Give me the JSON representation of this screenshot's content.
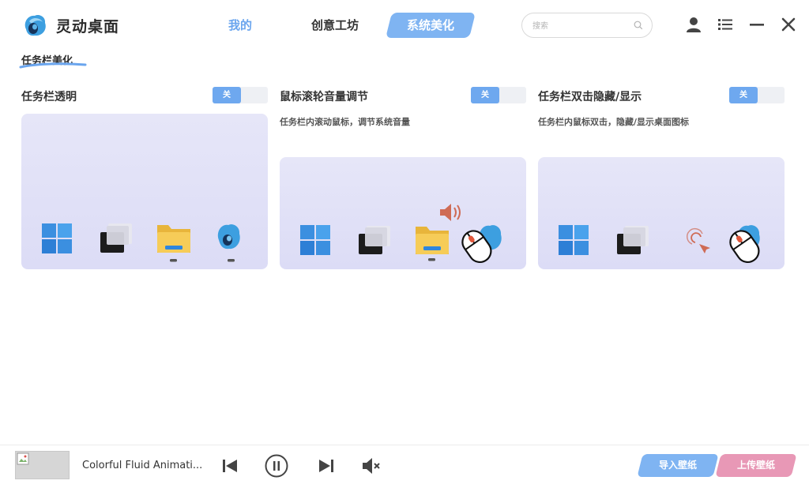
{
  "app": {
    "title": "灵动桌面"
  },
  "nav": {
    "tabs": [
      {
        "label": "我的",
        "active": false
      },
      {
        "label": "创意工坊",
        "active": false
      },
      {
        "label": "系统美化",
        "active": true
      }
    ]
  },
  "search": {
    "placeholder": "搜索",
    "value": ""
  },
  "window_controls": [
    "user-icon",
    "list-menu-icon",
    "minimize-icon",
    "close-icon"
  ],
  "section": {
    "title": "任务栏美化"
  },
  "features": [
    {
      "name": "任务栏透明",
      "description": "",
      "toggle_label": "关",
      "enabled": false
    },
    {
      "name": "鼠标滚轮音量调节",
      "description": "任务栏内滚动鼠标，调节系统音量",
      "toggle_label": "关",
      "enabled": false
    },
    {
      "name": "任务栏双击隐藏/显示",
      "description": "任务栏内鼠标双击，隐藏/显示桌面图标",
      "toggle_label": "关",
      "enabled": false
    }
  ],
  "player": {
    "track_title": "Colorful Fluid Animati...",
    "controls": [
      "previous-icon",
      "pause-icon",
      "next-icon",
      "mute-icon"
    ]
  },
  "actions": {
    "import_label": "导入壁纸",
    "upload_label": "上传壁纸"
  },
  "colors": {
    "accent_blue": "#7fb4f2",
    "active_tab_text": "#6aa5ee",
    "upload_pink": "#e898b6",
    "toggle_blue": "#6ea8ef",
    "preview_bg": "#e0e0f7"
  }
}
